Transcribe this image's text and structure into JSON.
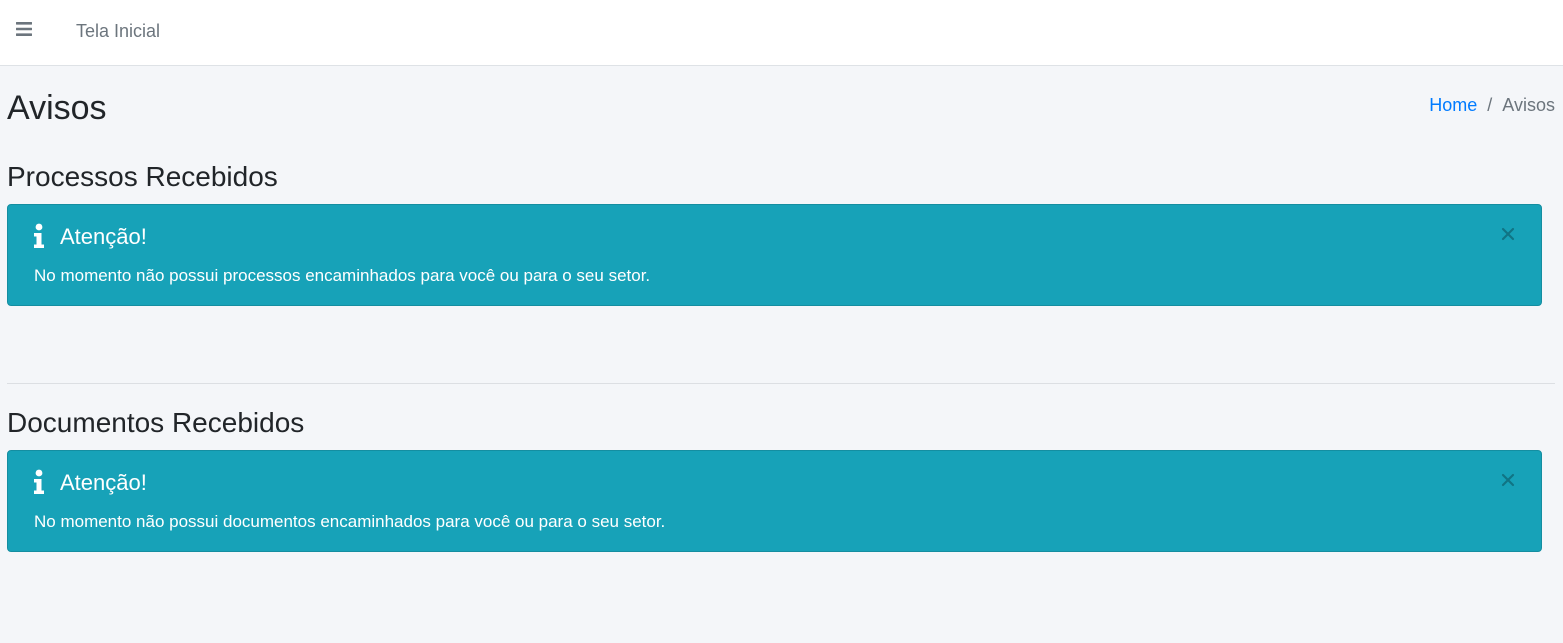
{
  "header": {
    "menu_icon": "hamburger-menu-icon",
    "nav_link": "Tela Inicial"
  },
  "page": {
    "title": "Avisos",
    "breadcrumb": {
      "home": "Home",
      "separator": "/",
      "current": "Avisos"
    }
  },
  "sections": [
    {
      "title": "Processos Recebidos",
      "alert": {
        "icon": "info-icon",
        "heading": "Atenção!",
        "text": "No momento não possui processos encaminhados para você ou para o seu setor.",
        "close": "×"
      }
    },
    {
      "title": "Documentos Recebidos",
      "alert": {
        "icon": "info-icon",
        "heading": "Atenção!",
        "text": "No momento não possui documentos encaminhados para você ou para o seu setor.",
        "close": "×"
      }
    }
  ],
  "colors": {
    "background": "#f4f6f9",
    "alert_info": "#17a2b8",
    "link": "#007bff",
    "muted": "#6c757d"
  }
}
